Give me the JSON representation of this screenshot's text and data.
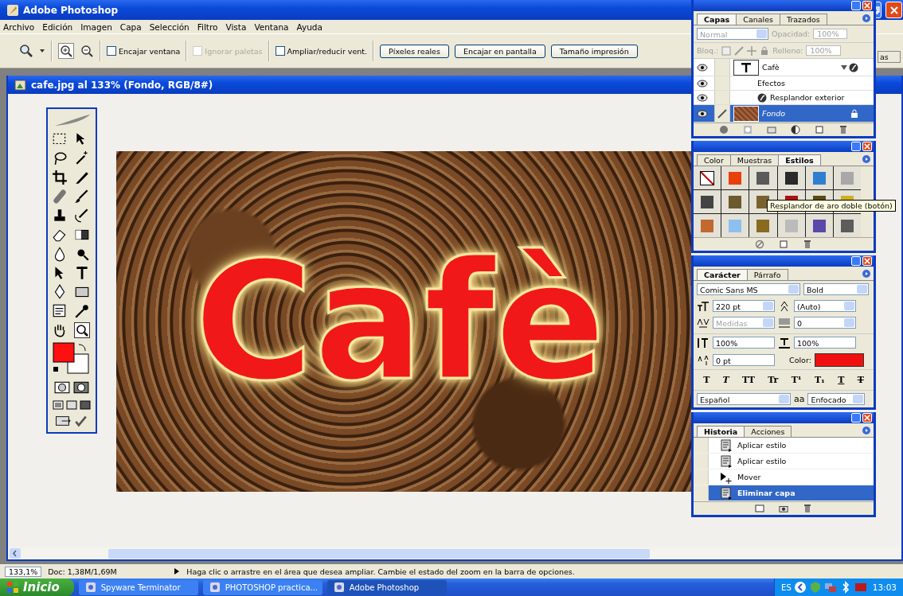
{
  "app_title": "Adobe Photoshop",
  "menu": [
    "Archivo",
    "Edición",
    "Imagen",
    "Capa",
    "Selección",
    "Filtro",
    "Vista",
    "Ventana",
    "Ayuda"
  ],
  "options_bar": {
    "checkboxes": [
      {
        "label": "Encajar ventana",
        "checked": false,
        "disabled": false
      },
      {
        "label": "Ignorar paletas",
        "checked": false,
        "disabled": true
      },
      {
        "label": "Ampliar/reducir vent.",
        "checked": false,
        "disabled": false
      }
    ],
    "buttons": [
      "Píxeles reales",
      "Encajar en pantalla",
      "Tamaño impresión"
    ]
  },
  "document": {
    "title": "cafe.jpg al 133% (Fondo, RGB/8#)",
    "canvas_text": "Cafè"
  },
  "layers_panel": {
    "tabs": [
      {
        "label": "Capas",
        "selected": true
      },
      {
        "label": "Canales",
        "selected": false
      },
      {
        "label": "Trazados",
        "selected": false
      }
    ],
    "blend_mode": "Normal",
    "opacity_label": "Opacidad:",
    "opacity": "100%",
    "lock_label": "Bloq.:",
    "fill_label": "Relleno:",
    "fill": "100%",
    "layers": [
      {
        "kind": "text",
        "name": "Cafè",
        "selected": false
      },
      {
        "kind": "effects",
        "name": "Efectos",
        "selected": false
      },
      {
        "kind": "effect",
        "name": "Resplandor exterior",
        "selected": false
      },
      {
        "kind": "image",
        "name": "Fondo",
        "selected": true
      }
    ],
    "hidden_panel_tab": "as"
  },
  "styles_panel": {
    "tabs": [
      {
        "label": "Color",
        "selected": false
      },
      {
        "label": "Muestras",
        "selected": false
      },
      {
        "label": "Estilos",
        "selected": true
      }
    ],
    "swatches": [
      {
        "color": "#ffffff"
      },
      {
        "color": "#e8400a"
      },
      {
        "color": "#5a5a5a"
      },
      {
        "color": "#2a2a2a"
      },
      {
        "color": "#2f7fd0"
      },
      {
        "color": "#a8a8a8"
      },
      {
        "color": "#444444"
      },
      {
        "color": "#6b5a2e"
      },
      {
        "color": "#7a6230"
      },
      {
        "color": "#b01010"
      },
      {
        "color": "#5a4a10"
      },
      {
        "color": "#d0b020"
      },
      {
        "color": "#c06a30"
      },
      {
        "color": "#8cc0ee"
      },
      {
        "color": "#8a6a20"
      },
      {
        "color": "#bbbbbb"
      },
      {
        "color": "#5a4aa8"
      },
      {
        "color": "#5c5c5c"
      }
    ],
    "tooltip": "Resplandor de aro doble (botón)"
  },
  "character_panel": {
    "tabs": [
      {
        "label": "Carácter",
        "selected": true
      },
      {
        "label": "Párrafo",
        "selected": false
      }
    ],
    "font": "Comic Sans MS",
    "style": "Bold",
    "size": "220 pt",
    "leading": "(Auto)",
    "kerning": "Medidas",
    "tracking": "0",
    "vertical_scale": "100%",
    "horizontal_scale": "100%",
    "baseline": "0 pt",
    "color_label": "Color:",
    "style_buttons": [
      {
        "kind": "bold",
        "label": "T"
      },
      {
        "kind": "italic",
        "label": "T"
      },
      {
        "kind": "caps",
        "label": "TT"
      },
      {
        "kind": "smallcaps",
        "label": "Tr"
      },
      {
        "kind": "super",
        "label": "T¹"
      },
      {
        "kind": "sub",
        "label": "T₁"
      },
      {
        "kind": "underline",
        "label": "T"
      },
      {
        "kind": "strike",
        "label": "T"
      }
    ],
    "language": "Español",
    "antialias_icon": "aa",
    "antialias": "Enfocado"
  },
  "history_panel": {
    "tabs": [
      {
        "label": "Historia",
        "selected": true
      },
      {
        "label": "Acciones",
        "selected": false
      }
    ],
    "items": [
      {
        "kind": "doc",
        "label": "Aplicar estilo",
        "selected": false
      },
      {
        "kind": "doc",
        "label": "Aplicar estilo",
        "selected": false
      },
      {
        "kind": "move",
        "label": "Mover",
        "selected": false
      },
      {
        "kind": "doc",
        "label": "Eliminar capa",
        "selected": true
      }
    ]
  },
  "status_bar": {
    "zoom": "133,1%",
    "doc_size": "Doc: 1,38M/1,69M",
    "hint": "Haga clic o arrastre en el área que desea ampliar. Cambie el estado del zoom en la barra de opciones."
  },
  "taskbar": {
    "start": "Inicio",
    "tasks": [
      {
        "label": "Spyware Terminator",
        "selected": false
      },
      {
        "label": "PHOTOSHOP practica...",
        "selected": false
      },
      {
        "label": "Adobe Photoshop",
        "selected": true
      }
    ],
    "language": "ES",
    "clock": "13:03"
  }
}
